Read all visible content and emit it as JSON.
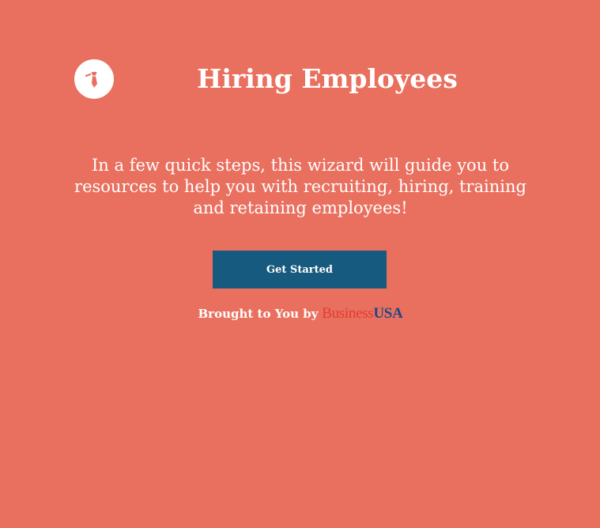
{
  "header": {
    "title": "Hiring Employees",
    "icon": "necktie-icon"
  },
  "main": {
    "intro": "In a few quick steps, this wizard will guide you to resources to help you with recruiting, hiring, training and retaining employees!",
    "cta_label": "Get Started"
  },
  "footer": {
    "credit_prefix": "Brought to You by",
    "brand_part1": "Business",
    "brand_part2": "USA"
  },
  "colors": {
    "background": "#e9705f",
    "button": "#175a7f",
    "brand_red": "#e23b2c",
    "brand_blue": "#1d4a82"
  }
}
